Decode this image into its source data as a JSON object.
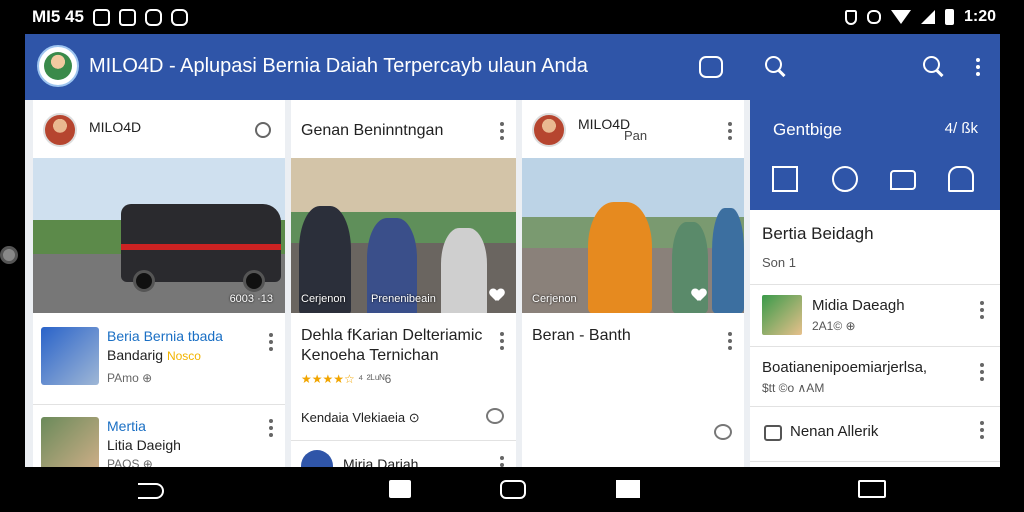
{
  "status_bar": {
    "left_text": "MI5 45",
    "time": "1:20"
  },
  "app_bar": {
    "title": "MILO4D - Aplupasi Bernia Daiah Terpercayb ulaun Anda",
    "icons": [
      "chat-icon",
      "search-icon",
      "search-icon",
      "more-icon"
    ]
  },
  "cards": {
    "c1": {
      "head_title": "MILO4D",
      "photo_caption": "6003 ·13",
      "items": [
        {
          "title_line1": "Beria Bernia tbada",
          "title_line2": "Bandarig",
          "title_tag": "Nosco",
          "meta": "PAmo ⊕"
        },
        {
          "title_line1": "Mertia",
          "title_line2": "Litia Daeigh",
          "meta": "PAOS ⊕"
        }
      ]
    },
    "c2": {
      "head_title": "Genan Beninntngan",
      "photo_caption_left": "Cerjenon",
      "photo_caption_right": "Prenenibeain",
      "text_line1": "Dehla fKarian Delteriamic",
      "text_line2": "Kenoeha Ternichan",
      "rating_stars": "★★★★☆",
      "rating_text": "⁴ ²ᴸᵘᴺ6",
      "footer_text": "Kendaia Vlekiaeia ⊙",
      "bottom_title": "Miria Dariah"
    },
    "c3": {
      "head_title": "MILO4D",
      "head_sub": "Pan",
      "photo_caption": "Cerjenon",
      "text_line": "Beran - Banth"
    }
  },
  "panel": {
    "title": "Gentbige",
    "count": "4/ ßk",
    "section_title": "Bertia Beidagh",
    "section_sub": "Son 1",
    "rows": [
      {
        "title": "Midia Daeagh",
        "meta": "2A1© ⊕"
      },
      {
        "title": "Boatianenipoemiarjerlsa,",
        "meta": "$tt ©o ∧AM"
      },
      {
        "title": "Nenan Allerik"
      }
    ]
  },
  "colors": {
    "primary": "#2f55a8",
    "link": "#1a6fc4",
    "star": "#f1a500"
  }
}
